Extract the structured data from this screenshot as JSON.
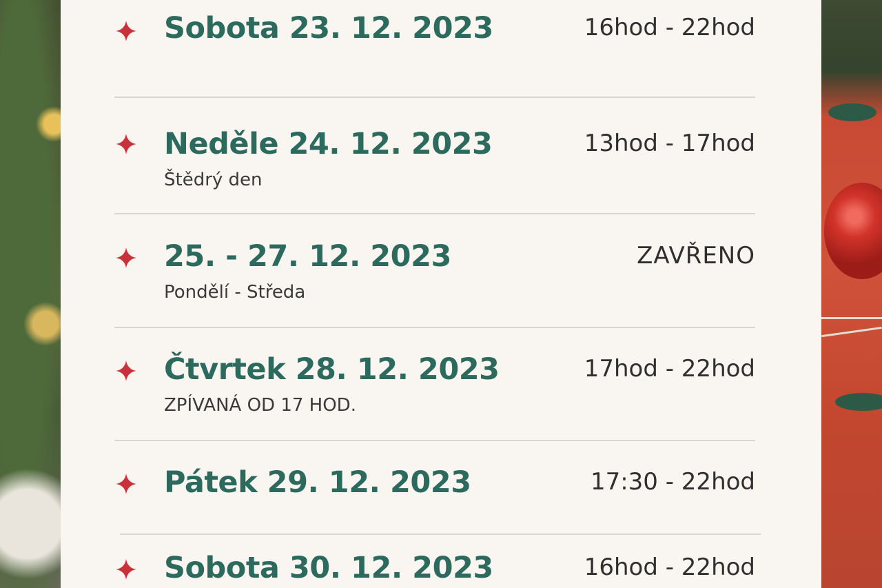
{
  "schedule": [
    {
      "date": "Sobota 23. 12. 2023",
      "note": "",
      "hours": "16hod - 22hod"
    },
    {
      "date": "Neděle 24. 12. 2023",
      "note": "Štědrý den",
      "hours": "13hod - 17hod"
    },
    {
      "date": "25. - 27. 12. 2023",
      "note": "Pondělí - Středa",
      "hours": "ZAVŘENO"
    },
    {
      "date": "Čtvrtek 28. 12. 2023",
      "note": "ZPÍVANÁ OD 17 HOD.",
      "hours": "17hod - 22hod"
    },
    {
      "date": "Pátek 29. 12. 2023",
      "note": "",
      "hours": "17:30 - 22hod"
    },
    {
      "date": "Sobota 30. 12. 2023",
      "note": "",
      "hours": "16hod - 22hod"
    }
  ],
  "colors": {
    "accent_green": "#2c6a5e",
    "star_red": "#c9323a",
    "card_bg": "#f9f6f1"
  },
  "icons": {
    "bullet": "four-point-star-icon"
  }
}
